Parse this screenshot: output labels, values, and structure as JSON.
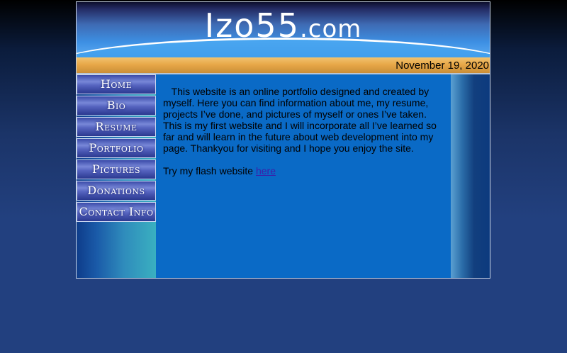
{
  "site": {
    "logo": "Izo55",
    "logo_domain": ".com"
  },
  "date": "November 19, 2020",
  "nav": [
    {
      "label": "Home"
    },
    {
      "label": "Bio"
    },
    {
      "label": "Resume"
    },
    {
      "label": "Portfolio"
    },
    {
      "label": "Pictures"
    },
    {
      "label": "Donations"
    },
    {
      "label": "Contact Info"
    }
  ],
  "content": {
    "intro": "This website is an online portfolio designed and created by myself. Here you can find information about me, my resume, projects I’ve done, and pictures of myself or ones I’ve taken. This is my first website and I will incorporate all I’ve learned so far and will learn in the future about web development into my page. Thankyou for visiting and I hope you enjoy the site.",
    "flash_prefix": "Try my flash website ",
    "flash_link": "here"
  },
  "colors": {
    "content_bg": "#0a6ac6",
    "link": "#3b1eaa",
    "date_bar": "#e8a848"
  }
}
